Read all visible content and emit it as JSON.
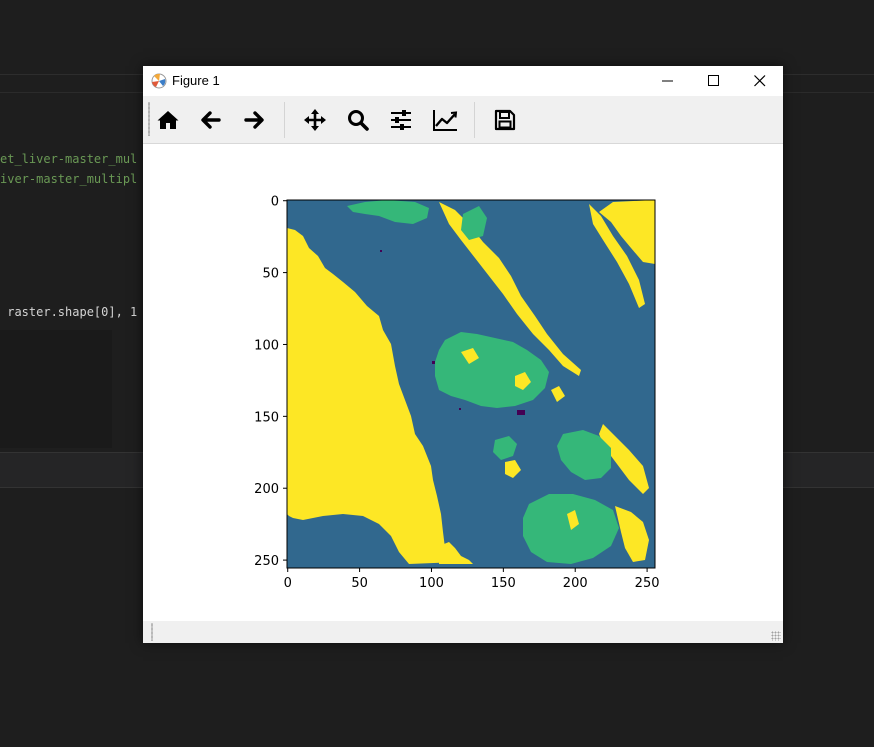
{
  "ide": {
    "line1": "et_liver-master_mul",
    "line2": "iver-master_multipl",
    "line3": " raster.shape[0], 1"
  },
  "window": {
    "title": "Figure 1",
    "app_icon": "matplotlib-icon",
    "controls": [
      "minimize-icon",
      "maximize-icon",
      "close-icon"
    ]
  },
  "toolbar": {
    "buttons": [
      {
        "name": "home",
        "icon": "home-icon"
      },
      {
        "name": "back",
        "icon": "arrow-left-icon"
      },
      {
        "name": "forward",
        "icon": "arrow-right-icon"
      },
      {
        "name": "pan",
        "icon": "move-icon"
      },
      {
        "name": "zoom",
        "icon": "magnifier-icon"
      },
      {
        "name": "configure-subplots",
        "icon": "sliders-icon"
      },
      {
        "name": "edit-axes",
        "icon": "line-chart-icon"
      },
      {
        "name": "save",
        "icon": "floppy-disk-icon"
      }
    ]
  },
  "plot": {
    "x_ticks": [
      "0",
      "50",
      "100",
      "150",
      "200",
      "250"
    ],
    "y_ticks": [
      "0",
      "50",
      "100",
      "150",
      "200",
      "250"
    ],
    "image_shape": [
      256,
      256
    ],
    "colormap": "viridis",
    "colors": {
      "background_class": "#31688e",
      "secondary_class": "#35b779",
      "dominant_class": "#fde725",
      "rare_class": "#440154"
    }
  },
  "chart_data": {
    "type": "heatmap",
    "title": "",
    "xlabel": "",
    "ylabel": "",
    "xlim": [
      0,
      256
    ],
    "ylim": [
      256,
      0
    ],
    "x_ticks": [
      0,
      50,
      100,
      150,
      200,
      250
    ],
    "y_ticks": [
      0,
      50,
      100,
      150,
      200,
      250
    ],
    "classes": [
      "#440154",
      "#31688e",
      "#35b779",
      "#fde725"
    ]
  }
}
